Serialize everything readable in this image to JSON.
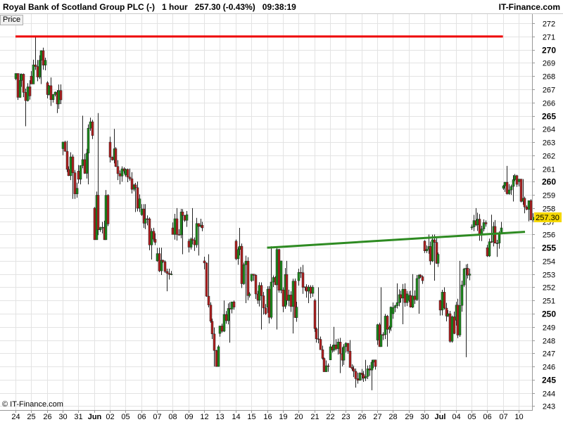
{
  "header": {
    "instrument": "Royal Bank of Scotland Group PLC (-)",
    "interval": "1 hour",
    "last_change": "257.30 (-0.43%)",
    "time": "09:38:19",
    "site": "IT-Finance.com"
  },
  "panel_label": "Price",
  "copyright": "© IT-Finance.com",
  "chart_data": {
    "type": "candlestick",
    "ylim": [
      242.7,
      272.7
    ],
    "y_ticks": [
      243,
      244,
      245,
      246,
      247,
      248,
      249,
      250,
      251,
      252,
      253,
      254,
      255,
      256,
      257,
      258,
      259,
      260,
      261,
      262,
      263,
      264,
      265,
      266,
      267,
      268,
      269,
      270,
      271,
      272
    ],
    "y_ticks_bold": [
      245,
      250,
      255,
      260,
      265,
      270
    ],
    "x_labels": [
      "24",
      "25",
      "26",
      "30",
      "31",
      "Jun",
      "02",
      "05",
      "06",
      "07",
      "08",
      "09",
      "12",
      "13",
      "14",
      "15",
      "16",
      "19",
      "20",
      "21",
      "22",
      "23",
      "26",
      "27",
      "28",
      "29",
      "30",
      "Jul",
      "04",
      "05",
      "06",
      "07",
      "10"
    ],
    "last_price": "257.30",
    "colors": {
      "up": "#1a8a1a",
      "down": "#b01e1e",
      "resistance": "#ee0000",
      "trendline": "#2e8b22",
      "price_tag": "#f5d800"
    },
    "resistance_line": {
      "price": 271.0,
      "from": "24",
      "to": "07"
    },
    "trend_line": {
      "from": {
        "date": "16",
        "price": 255.0
      },
      "to": {
        "date": "10",
        "price": 256.2
      }
    },
    "daily_ranges": [
      {
        "date": "24",
        "open": 267.8,
        "high": 268.2,
        "low": 264.2,
        "close": 266.5
      },
      {
        "date": "25",
        "open": 268.0,
        "high": 271.0,
        "low": 267.4,
        "close": 269.2
      },
      {
        "date": "26",
        "open": 267.5,
        "high": 267.9,
        "low": 265.2,
        "close": 266.2
      },
      {
        "date": "30",
        "open": 262.5,
        "high": 263.1,
        "low": 258.7,
        "close": 259.5
      },
      {
        "date": "31",
        "open": 260.8,
        "high": 265.0,
        "low": 259.8,
        "close": 263.5
      },
      {
        "date": "Jun",
        "open": 258.0,
        "high": 265.2,
        "low": 255.6,
        "close": 256.8
      },
      {
        "date": "02",
        "open": 263.0,
        "high": 264.0,
        "low": 259.8,
        "close": 260.8
      },
      {
        "date": "05",
        "open": 260.5,
        "high": 261.0,
        "low": 257.7,
        "close": 258.7
      },
      {
        "date": "06",
        "open": 257.5,
        "high": 258.3,
        "low": 254.1,
        "close": 255.4
      },
      {
        "date": "07",
        "open": 254.0,
        "high": 255.0,
        "low": 251.7,
        "close": 253.0
      },
      {
        "date": "08",
        "open": 256.5,
        "high": 258.0,
        "low": 254.5,
        "close": 257.5
      },
      {
        "date": "09",
        "open": 255.5,
        "high": 258.0,
        "low": 254.4,
        "close": 256.5
      },
      {
        "date": "12",
        "open": 254.0,
        "high": 254.5,
        "low": 246.0,
        "close": 247.5
      },
      {
        "date": "13",
        "open": 248.5,
        "high": 251.0,
        "low": 247.8,
        "close": 250.5
      },
      {
        "date": "14",
        "open": 255.5,
        "high": 256.5,
        "low": 250.8,
        "close": 251.5
      },
      {
        "date": "15",
        "open": 252.5,
        "high": 253.0,
        "low": 248.8,
        "close": 250.0
      },
      {
        "date": "16",
        "open": 250.5,
        "high": 255.1,
        "low": 248.8,
        "close": 254.0
      },
      {
        "date": "19",
        "open": 251.8,
        "high": 254.0,
        "low": 248.5,
        "close": 250.5
      },
      {
        "date": "20",
        "open": 252.5,
        "high": 253.7,
        "low": 250.8,
        "close": 252.0
      },
      {
        "date": "21",
        "open": 251.0,
        "high": 252.0,
        "low": 245.6,
        "close": 246.0
      },
      {
        "date": "22",
        "open": 246.5,
        "high": 249.0,
        "low": 245.5,
        "close": 247.5
      },
      {
        "date": "23",
        "open": 247.5,
        "high": 248.0,
        "low": 244.4,
        "close": 245.5
      },
      {
        "date": "26",
        "open": 245.5,
        "high": 246.5,
        "low": 244.2,
        "close": 246.0
      },
      {
        "date": "27",
        "open": 248.0,
        "high": 252.0,
        "low": 247.5,
        "close": 250.5
      },
      {
        "date": "28",
        "open": 250.0,
        "high": 252.3,
        "low": 249.2,
        "close": 251.5
      },
      {
        "date": "29",
        "open": 251.0,
        "high": 253.0,
        "low": 250.0,
        "close": 252.5
      },
      {
        "date": "30",
        "open": 255.5,
        "high": 256.0,
        "low": 252.5,
        "close": 254.5
      },
      {
        "date": "Jul",
        "open": 251.0,
        "high": 252.0,
        "low": 247.8,
        "close": 248.5
      },
      {
        "date": "04",
        "open": 249.5,
        "high": 254.0,
        "low": 246.7,
        "close": 253.0
      },
      {
        "date": "05",
        "open": 256.5,
        "high": 258.0,
        "low": 255.5,
        "close": 256.8
      },
      {
        "date": "06",
        "open": 255.0,
        "high": 257.5,
        "low": 254.3,
        "close": 256.5
      },
      {
        "date": "07",
        "open": 259.5,
        "high": 261.2,
        "low": 258.5,
        "close": 259.8
      },
      {
        "date": "10",
        "open": 260.0,
        "high": 260.2,
        "low": 257.0,
        "close": 257.3
      }
    ]
  }
}
